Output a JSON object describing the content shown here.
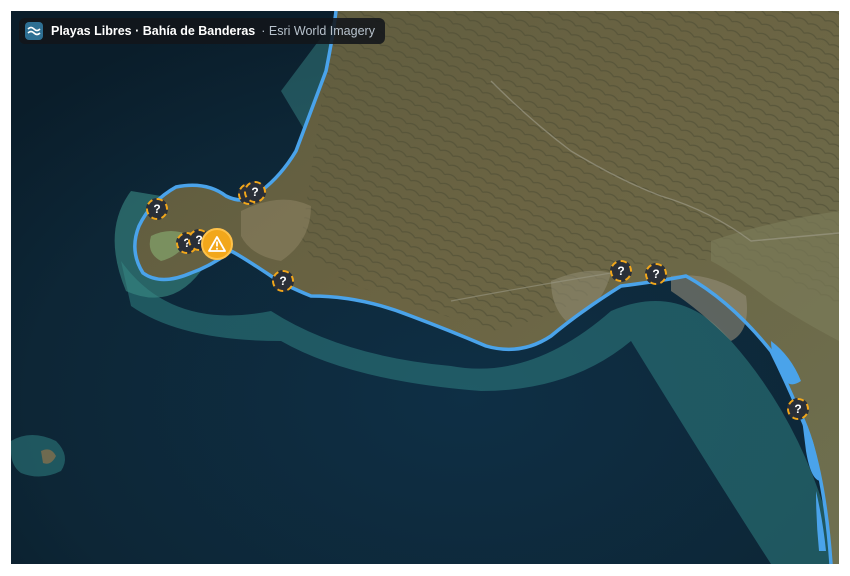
{
  "header": {
    "title": "Playas Libres · Bahía de Banderas",
    "source": "· Esri World Imagery",
    "logo_icon": "waves-icon"
  },
  "map": {
    "basemap": "satellite imagery",
    "coastline_color": "#4aa3ea",
    "marker_color": "#f2a71b",
    "unknown_glyph": "?",
    "alert_icon": "warning-triangle-icon"
  }
}
